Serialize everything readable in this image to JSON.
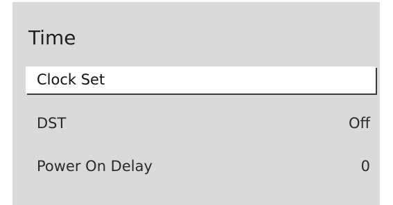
{
  "panel": {
    "title": "Time",
    "items": [
      {
        "label": "Clock Set",
        "value": "",
        "selected": true
      },
      {
        "label": "DST",
        "value": "Off",
        "selected": false
      },
      {
        "label": "Power On Delay",
        "value": "0",
        "selected": false
      }
    ]
  }
}
